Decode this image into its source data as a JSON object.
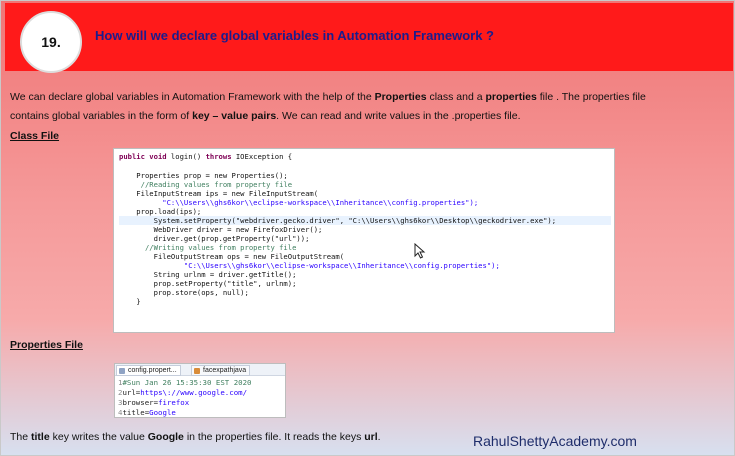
{
  "slide": {
    "number": "19.",
    "title": "How will we declare global variables in Automation Framework ?"
  },
  "intro": {
    "p1_a": "We can declare global variables in Automation Framework with the help of the ",
    "p1_b1": "Properties",
    "p1_c": " class and a ",
    "p1_b2": "properties",
    "p1_d": " file . The properties file",
    "p2_a": " contains  global variables in the form of ",
    "p2_b": "key – value pairs",
    "p2_c": ". We can read and write values in the .properties file."
  },
  "class_file": {
    "label": "Class File",
    "lines": [
      {
        "kw": "public void",
        "rest": " login() ",
        "kw2": "throws",
        "rest2": " IOException {"
      },
      {
        "text": ""
      },
      {
        "text": "    Properties prop = new Properties();"
      },
      {
        "comment": "     //Reading values from property file"
      },
      {
        "text": "    FileInputStream ips = new FileInputStream("
      },
      {
        "str": "          \"C:\\\\Users\\\\ghs6kor\\\\eclipse-workspace\\\\Inheritance\\\\config.properties\");"
      },
      {
        "text": "    prop.load(ips);"
      },
      {
        "text": "        System.setProperty(\"webdriver.gecko.driver\", \"C:\\\\Users\\\\ghs6kor\\\\Desktop\\\\geckodriver.exe\");"
      },
      {
        "text": "        WebDriver driver = new FirefoxDriver();"
      },
      {
        "text": "        driver.get(prop.getProperty(\"url\"));"
      },
      {
        "comment": "      //Writing values from property file"
      },
      {
        "text": "        FileOutputStream ops = new FileOutputStream("
      },
      {
        "str": "               \"C:\\\\Users\\\\ghs6kor\\\\eclipse-workspace\\\\Inheritance\\\\config.properties\");"
      },
      {
        "text": "        String urlnm = driver.getTitle();"
      },
      {
        "text": "        prop.setProperty(\"title\", urlnm);"
      },
      {
        "text": "        prop.store(ops, null);"
      },
      {
        "text": "    }"
      }
    ]
  },
  "properties_file": {
    "label": "Properties File",
    "tabs": [
      "config.propert...",
      "facexpathjava"
    ],
    "lines": [
      {
        "n": "1",
        "comment": "#Sun Jan 26 15:35:30 EST 2020"
      },
      {
        "n": "2",
        "key": "url=",
        "value": "https\\://www.google.com/"
      },
      {
        "n": "3",
        "key": "browser=",
        "value": "firefox"
      },
      {
        "n": "4",
        "key": "title=",
        "value": "Google"
      }
    ]
  },
  "footer": {
    "a": "The ",
    "b1": "title",
    "c": "  key writes the value ",
    "b2": "Google",
    "d": " in the properties file. It reads the keys ",
    "b3": "url",
    "e": "."
  },
  "brand": "RahulShettyAcademy.com",
  "colors": {
    "header_red": "#ff1a1a",
    "title_blue": "#1c1c8c",
    "brand_blue": "#1e2d6b"
  }
}
